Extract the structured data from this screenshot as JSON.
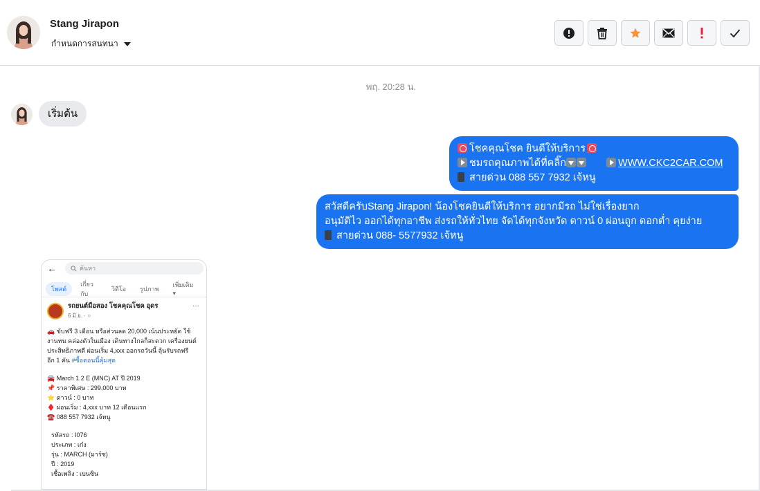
{
  "header": {
    "contact_name": "Stang Jirapon",
    "conversation_settings": "กำหนดการสนทนา",
    "actions": [
      {
        "name": "mark-spam-button",
        "icon": "alert-circle-icon",
        "color": "#1c1e21"
      },
      {
        "name": "delete-button",
        "icon": "trash-icon",
        "color": "#1c1e21"
      },
      {
        "name": "star-button",
        "icon": "star-icon",
        "color": "#f7923b"
      },
      {
        "name": "mark-unread-button",
        "icon": "envelope-icon",
        "color": "#1c1e21"
      },
      {
        "name": "follow-up-button",
        "icon": "exclamation-icon",
        "color": "#e41e3f"
      },
      {
        "name": "mark-done-button",
        "icon": "checkmark-icon",
        "color": "#1c1e21"
      }
    ]
  },
  "thread": {
    "timestamp": "พฤ. 20:28 น.",
    "incoming_message": "เริ่มต้น",
    "outgoing_1": {
      "line1": "โชคคุณโชค ยินดีให้บริการ",
      "line2_text": "ชมรถคุณภาพได้ที่คลิ๊ก",
      "line2_link": "WWW.CKC2CAR.COM",
      "line3": "สายด่วน 088 557 7932 เจ้หนู"
    },
    "outgoing_2": {
      "line1": "สวัสดีครับStang Jirapon! น้องโชคยินดีให้บริการ อยากมีรถ ไม่ใช่เรื่องยาก",
      "line2": "อนุมัติไว ออกได้ทุกอาชีพ ส่งรถให้ทั่วไทย จัดได้ทุกจังหวัด ดาวน์ 0  ผ่อนถูก ดอกต่ำ คุยง่าย",
      "line3": "สายด่วน 088- 5577932 เจ้หนู"
    },
    "attachment": {
      "search_placeholder": "ค้นหา",
      "tabs": [
        "โพสต์",
        "เกี่ยวกับ",
        "วิดีโอ",
        "รูปภาพ",
        "เพิ่มเติม"
      ],
      "author": "รถยนต์มือสอง โชคคุณโชค อุดร",
      "date": "6 มิ.ย. · ",
      "body_1": "🚗 ขับฟรี 3 เดือน หรือส่วนลด 20,000 เน้นประหยัด ใช้",
      "body_2": "งานทน คล่องตัวในเมือง เดินทางไกลก็สะดวก เครื่องยนต์",
      "body_3": "ประสิทธิภาพดี ผ่อนเริ่ม 4,xxx ออกรถวันนี้ ลุ้นรับรถฟรี",
      "body_4": "อีก 1 คัน",
      "hashtag": "#ซื้อตอนนี้คุ้มสุด",
      "spec_1": "🚘 March 1.2 E (MNC) AT ปี 2019",
      "spec_2": "📌 ราคาพิเศษ : 299,000 บาท",
      "spec_3": "⭐ ดาวน์ : 0 บาท",
      "spec_4": "♦️ ผ่อนเริ่ม : 4,xxx บาท 12 เดือนแรก",
      "spec_5": "☎️ 088 557 7932 เจ้หนู",
      "detail_1": "รหัสรถ : I076",
      "detail_2": "ประเภท : เก๋ง",
      "detail_3": "รุ่น : MARCH (มาร์ช)",
      "detail_4": "ปี : 2019",
      "detail_5": "เชื้อเพลิง : เบนซิน"
    }
  },
  "colors": {
    "outgoing_bubble": "#1a73f0",
    "incoming_bubble": "#e9eaed",
    "star": "#f7923b",
    "flag": "#e41e3f"
  }
}
